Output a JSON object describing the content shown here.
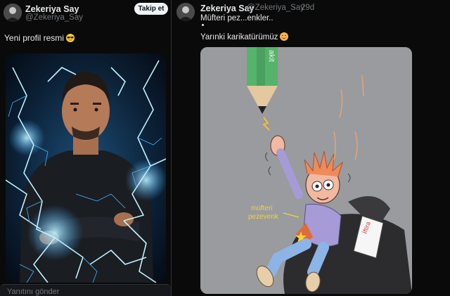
{
  "left_tweet": {
    "author_name": "Zekeriya Say",
    "author_handle": "@Zekeriya_Say",
    "follow_label": "Takip et",
    "text": "Yeni profil resmi",
    "emoji": "sunglasses-emoji",
    "media": "man-with-lightning-photo"
  },
  "right_tweet": {
    "author_name": "Zekeriya Say",
    "author_handle": "@Zekeriya_Say",
    "separator": "·",
    "time": "29d",
    "line1": "Müfteri pez...enkler..",
    "line2": "Yarınki karikatürümüz",
    "emoji": "smiling-face-emoji",
    "media": "cartoon-pencil-lightning",
    "cartoon_texts": {
      "pencil_brand": "akit",
      "figure_label_1": "müfteri",
      "figure_label_2": "pezevenk",
      "paper_label": "İftira"
    }
  },
  "reply_box": {
    "placeholder": "Yanıtını gönder"
  },
  "colors": {
    "background": "#0a0a0a",
    "text": "#e7e9ea",
    "secondary": "#71767b",
    "border": "#2f3336",
    "lightning": "#4fc3ff",
    "pencil_green": "#56b36b"
  }
}
